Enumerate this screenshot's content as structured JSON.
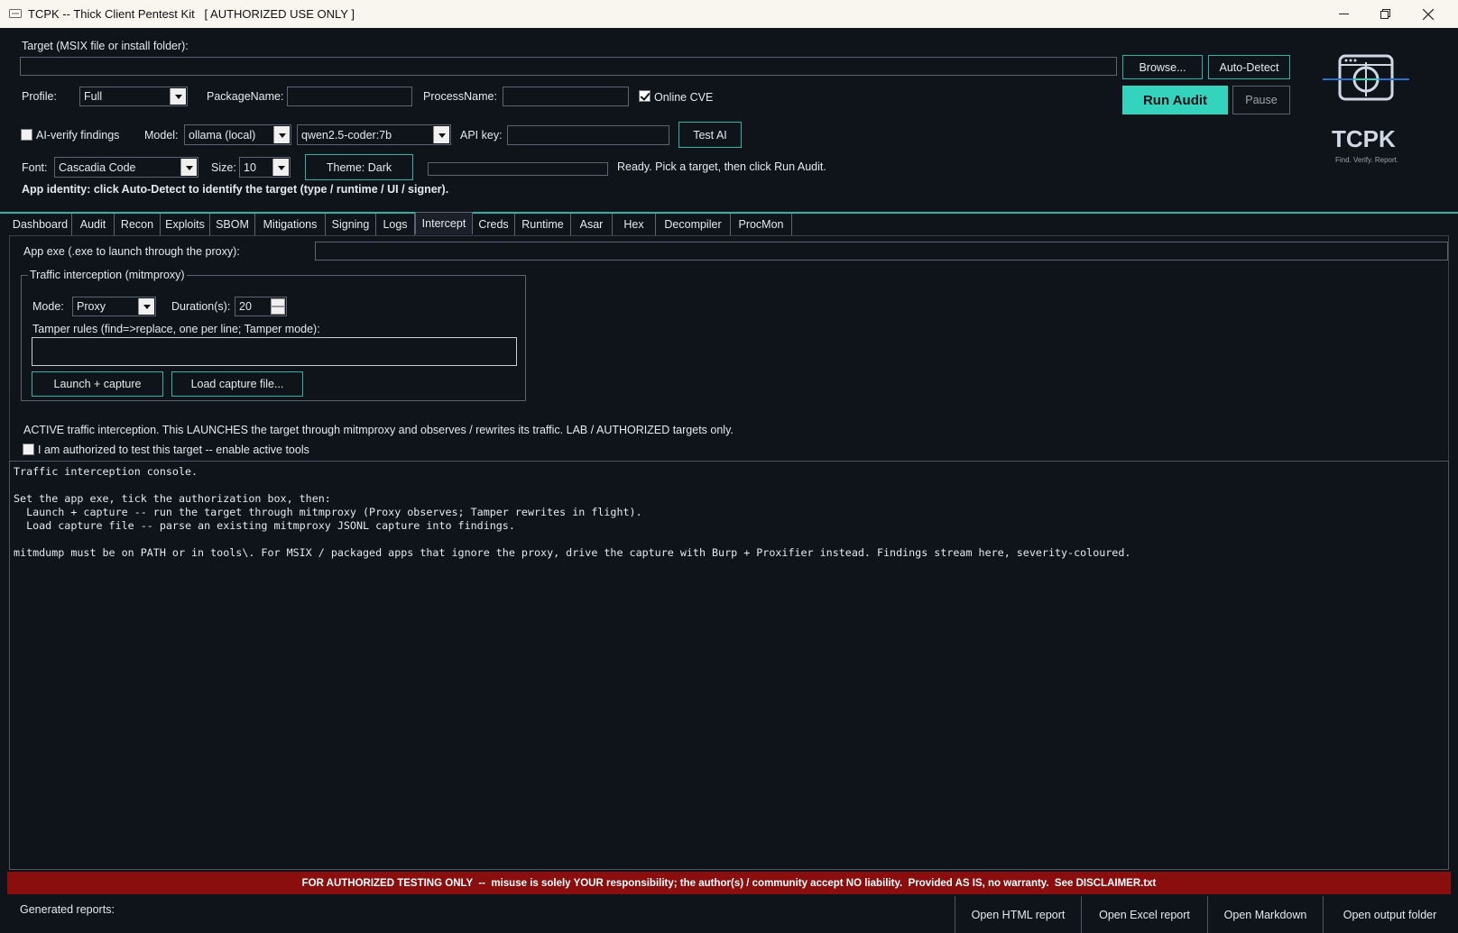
{
  "window": {
    "title": "TCPK -- Thick Client Pentest Kit   [ AUTHORIZED USE ONLY ]"
  },
  "target": {
    "label": "Target (MSIX file or install folder):",
    "value": "",
    "browse_label": "Browse...",
    "autodetect_label": "Auto-Detect"
  },
  "profile": {
    "label": "Profile:",
    "value": "Full",
    "package_label": "PackageName:",
    "package_value": "",
    "process_label": "ProcessName:",
    "process_value": "",
    "online_cve_label": "Online CVE",
    "online_cve_checked": true
  },
  "actions": {
    "run_label": "Run Audit",
    "pause_label": "Pause"
  },
  "ai": {
    "verify_label": "AI-verify findings",
    "verify_checked": false,
    "model_label": "Model:",
    "provider_value": "ollama (local)",
    "model_value": "qwen2.5-coder:7b",
    "apikey_label": "API key:",
    "apikey_value": "",
    "test_label": "Test AI"
  },
  "appearance": {
    "font_label": "Font:",
    "font_value": "Cascadia Code",
    "size_label": "Size:",
    "size_value": "10",
    "theme_label": "Theme: Dark",
    "progress": 0,
    "status_text": "Ready. Pick a target, then click Run Audit."
  },
  "identity_text": "App identity: click Auto-Detect to identify the target (type / runtime / UI / signer).",
  "logo": {
    "name": "TCPK",
    "tagline": "Find. Verify. Report."
  },
  "tabs": [
    {
      "label": "Dashboard"
    },
    {
      "label": "Audit"
    },
    {
      "label": "Recon"
    },
    {
      "label": "Exploits"
    },
    {
      "label": "SBOM"
    },
    {
      "label": "Mitigations"
    },
    {
      "label": "Signing"
    },
    {
      "label": "Logs"
    },
    {
      "label": "Intercept",
      "active": true
    },
    {
      "label": "Creds"
    },
    {
      "label": "Runtime"
    },
    {
      "label": "Asar"
    },
    {
      "label": "Hex"
    },
    {
      "label": "Decompiler"
    },
    {
      "label": "ProcMon"
    }
  ],
  "intercept": {
    "app_exe_label": "App exe (.exe to launch through the proxy):",
    "app_exe_value": "",
    "group_title": "Traffic interception (mitmproxy)",
    "mode_label": "Mode:",
    "mode_value": "Proxy",
    "duration_label": "Duration(s):",
    "duration_value": "20",
    "tamper_label": "Tamper rules (find=>replace, one per line; Tamper mode):",
    "tamper_value": "",
    "launch_label": "Launch + capture",
    "load_label": "Load capture file...",
    "warning_text": "ACTIVE traffic interception. This LAUNCHES the target through mitmproxy and observes / rewrites its traffic. LAB / AUTHORIZED targets only.",
    "authorized_label": "I am authorized to test this target -- enable active tools",
    "authorized_checked": false
  },
  "console": {
    "lines": [
      "Traffic interception console.",
      "",
      "Set the app exe, tick the authorization box, then:",
      "  Launch + capture -- run the target through mitmproxy (Proxy observes; Tamper rewrites in flight).",
      "  Load capture file -- parse an existing mitmproxy JSONL capture into findings.",
      "",
      "mitmdump must be on PATH or in tools\\. For MSIX / packaged apps that ignore the proxy, drive the capture with Burp + Proxifier instead. Findings stream here, severity-coloured."
    ]
  },
  "banner_text": "FOR AUTHORIZED TESTING ONLY  --  misuse is solely YOUR responsibility; the author(s) / community accept NO liability.  Provided AS IS, no warranty.  See DISCLAIMER.txt",
  "footer": {
    "reports_label": "Generated reports:",
    "buttons": [
      {
        "label": "Open HTML report"
      },
      {
        "label": "Open Excel report"
      },
      {
        "label": "Open Markdown"
      },
      {
        "label": "Open output folder"
      }
    ]
  },
  "colors": {
    "accent": "#33d3bd",
    "border_accent": "#2bb4a6",
    "background": "#0f141b",
    "banner": "#8a0e0e"
  }
}
